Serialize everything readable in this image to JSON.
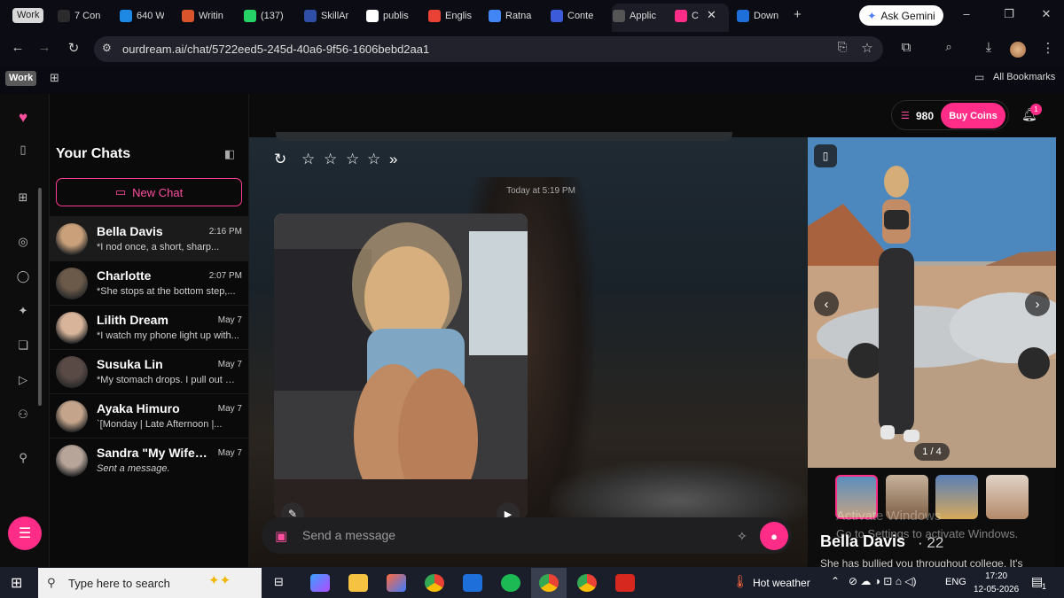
{
  "browser": {
    "work_chip": "Work",
    "tabs": [
      {
        "label": "7 Con",
        "icon": "info-icon",
        "color": "#2b2b2b"
      },
      {
        "label": "640 W",
        "icon": "is-icon",
        "color": "#1e88e5"
      },
      {
        "label": "Writin",
        "icon": "sunburst-icon",
        "color": "#d9542b"
      },
      {
        "label": "(137)",
        "icon": "whatsapp-icon",
        "color": "#25d366"
      },
      {
        "label": "SkillAr",
        "icon": "x-logo-icon",
        "color": "#2f4ea8"
      },
      {
        "label": "publis",
        "icon": "google-icon",
        "color": "#ffffff"
      },
      {
        "label": "Englis",
        "icon": "gmail-icon",
        "color": "#ea4335"
      },
      {
        "label": "Ratna",
        "icon": "docs-icon",
        "color": "#4285f4"
      },
      {
        "label": "Conte",
        "icon": "circle-icon",
        "color": "#3b5bdb"
      },
      {
        "label": "Applic",
        "icon": "chatgpt-icon",
        "color": "#555555"
      },
      {
        "label": "C",
        "icon": "heart-icon",
        "color": "#ff2d87"
      },
      {
        "label": "Down",
        "icon": "download-icon",
        "color": "#1e6fd9"
      }
    ],
    "ask_gemini": "Ask Gemini",
    "url": "ourdream.ai/chat/5722eed5-245d-40a6-9f56-1606bebd2aa1",
    "bookmarks_work": "Work",
    "all_bookmarks": "All Bookmarks"
  },
  "chat_list": {
    "title": "Your Chats",
    "new_chat": "New Chat",
    "chats": [
      {
        "name": "Bella Davis",
        "time": "2:16 PM",
        "preview": "*I nod once, a short, sharp...",
        "avatar_color": "#c9a07a"
      },
      {
        "name": "Charlotte",
        "time": "2:07 PM",
        "preview": "*She stops at the bottom step,...",
        "avatar_color": "#6b5a4a"
      },
      {
        "name": "Lilith Dream",
        "time": "May 7",
        "preview": "*I watch my phone light up with...",
        "avatar_color": "#d8b49a"
      },
      {
        "name": "Susuka Lin",
        "time": "May 7",
        "preview": "*My stomach drops. I pull out m...",
        "avatar_color": "#5a4a45"
      },
      {
        "name": "Ayaka Himuro",
        "time": "May 7",
        "preview": "`[Monday | Late Afternoon |...",
        "avatar_color": "#c4a48a"
      },
      {
        "name": "Sandra \"My Wife, ...",
        "time": "May 7",
        "preview": "Sent a message.",
        "avatar_color": "#b7a59a"
      }
    ]
  },
  "header": {
    "coins": "980",
    "buy_coins": "Buy Coins",
    "notification_count": "1"
  },
  "conversation": {
    "timestamp": "Today at 5:19 PM",
    "input_placeholder": "Send a message"
  },
  "character": {
    "counter": "1 / 4",
    "name": "Bella Davis",
    "age": "· 22",
    "bio": "She has bullied you throughout college. It's"
  },
  "watermark": {
    "line1": "Activate Windows",
    "line2": "Go to Settings to activate Windows."
  },
  "taskbar": {
    "search_placeholder": "Type here to search",
    "weather": "Hot weather",
    "lang": "ENG",
    "time": "17:20",
    "date": "12-05-2026",
    "notif_count": "1"
  }
}
